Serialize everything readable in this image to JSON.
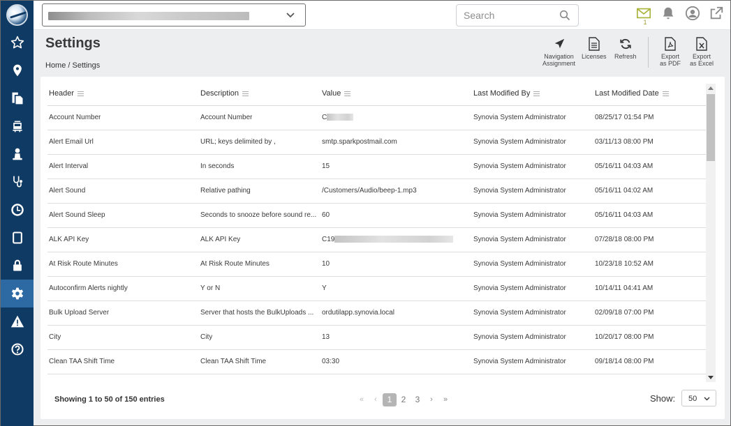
{
  "topbar": {
    "search_placeholder": "Search",
    "mail_count": "1"
  },
  "header": {
    "title": "Settings",
    "breadcrumb": "Home / Settings"
  },
  "toolbar": {
    "nav_line1": "Navigation",
    "nav_line2": "Assignment",
    "licenses": "Licenses",
    "refresh": "Refresh",
    "pdf_line1": "Export",
    "pdf_line2": "as PDF",
    "excel_line1": "Export",
    "excel_line2": "as Excel"
  },
  "table": {
    "columns": [
      "Header",
      "Description",
      "Value",
      "Last Modified By",
      "Last Modified Date"
    ],
    "rows": [
      {
        "header": "Account Number",
        "description": "Account Number",
        "value": "C",
        "modified_by": "Synovia System Administrator",
        "modified_date": "08/25/17 01:54 PM"
      },
      {
        "header": "Alert Email Url",
        "description": "URL; keys delimited by ,",
        "value": "smtp.sparkpostmail.com",
        "modified_by": "Synovia System Administrator",
        "modified_date": "03/11/13 08:00 PM"
      },
      {
        "header": "Alert Interval",
        "description": "In seconds",
        "value": "15",
        "modified_by": "Synovia System Administrator",
        "modified_date": "05/16/11 04:03 AM"
      },
      {
        "header": "Alert Sound",
        "description": "Relative pathing",
        "value": "/Customers/Audio/beep-1.mp3",
        "modified_by": "Synovia System Administrator",
        "modified_date": "05/16/11 04:02 AM"
      },
      {
        "header": "Alert Sound Sleep",
        "description": "Seconds to snooze before sound re...",
        "value": "60",
        "modified_by": "Synovia System Administrator",
        "modified_date": "05/16/11 04:03 AM"
      },
      {
        "header": "ALK API Key",
        "description": "ALK API Key",
        "value": "C19",
        "modified_by": "Synovia System Administrator",
        "modified_date": "07/28/18 08:00 PM"
      },
      {
        "header": "At Risk Route Minutes",
        "description": "At Risk Route Minutes",
        "value": "10",
        "modified_by": "Synovia System Administrator",
        "modified_date": "10/23/18 10:52 AM"
      },
      {
        "header": "Autoconfirm Alerts nightly",
        "description": "Y or N",
        "value": "Y",
        "modified_by": "Synovia System Administrator",
        "modified_date": "10/14/11 04:41 AM"
      },
      {
        "header": "Bulk Upload Server",
        "description": "Server that hosts the BulkUploads ...",
        "value": "ordutilapp.synovia.local",
        "modified_by": "Synovia System Administrator",
        "modified_date": "02/09/18 07:00 PM"
      },
      {
        "header": "City",
        "description": "City",
        "value": "13",
        "modified_by": "Synovia System Administrator",
        "modified_date": "10/20/17 08:00 PM"
      },
      {
        "header": "Clean TAA Shift Time",
        "description": "Clean TAA Shift Time",
        "value": "03:30",
        "modified_by": "Synovia System Administrator",
        "modified_date": "09/18/14 08:00 PM"
      }
    ]
  },
  "footer": {
    "entries": "Showing 1 to 50 of 150 entries",
    "pages": [
      "1",
      "2",
      "3"
    ],
    "first": "«",
    "prev": "‹",
    "next": "›",
    "last": "»",
    "show_label": "Show:",
    "show_value": "50"
  }
}
